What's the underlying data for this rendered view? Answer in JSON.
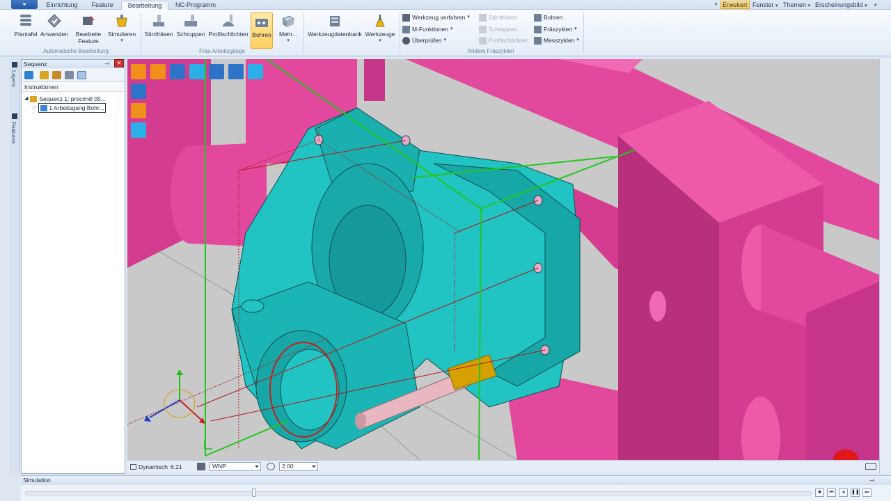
{
  "menu_tabs": [
    "Einrichtung",
    "Feature",
    "Bearbeitung",
    "NC-Programm"
  ],
  "menu_right": {
    "erweitert": "Erweitert",
    "fenster": "Fenster",
    "themen": "Themen",
    "erscheinungsbild": "Erscheinungsbild"
  },
  "ribbon": {
    "plantafel": "Plantafel",
    "anwenden": "Anwenden",
    "bearbeite_feature_1": "Bearbeite",
    "bearbeite_feature_2": "Feature",
    "simulieren": "Simulieren",
    "group_auto": "Automatische Bearbeitung",
    "stirnfraesen": "Stirnfräsen",
    "schruppen": "Schruppen",
    "profilschlichten": "Profilschlichten",
    "bohren": "Bohren",
    "mehr": "Mehr...",
    "group_fraes": "Fräs-Arbeitsgänge",
    "werkzeugdatenbank": "Werkzeugdatenbank",
    "werkzeuge": "Werkzeuge",
    "werkzeug_verfahren": "Werkzeug verfahren",
    "m_funktionen": "M-Funktionen",
    "ueberpruefen": "Überprüfen",
    "stirnfraesen_sm": "Stirnfräsen",
    "schruppen_sm": "Schruppen",
    "profilschlichten_sm": "Profilschlichten",
    "bohren_sm": "Bohren",
    "fraeszyklen": "Fräszyklen",
    "messzyklen": "Messzyklen",
    "group_andere": "Andere Fräszyklen"
  },
  "left_strip": {
    "layers": "Layers",
    "features": "Features"
  },
  "sequence_panel": {
    "title": "Sequenz",
    "column_header": "Instruktionen",
    "tree": [
      {
        "label": "Sequenz 1: precimill 05..."
      },
      {
        "label": "1 Arbeitsgang Bohr..."
      }
    ]
  },
  "viewport_status": {
    "mode": "Dynamisch",
    "value": "6.21",
    "coord_system": "WNP",
    "zoom": "2.00"
  },
  "simulation": {
    "title": "Simulation",
    "progress": 0.29
  },
  "colors": {
    "part": "#22c3c3",
    "fixture": "#e2489c",
    "tool_holder": "#d6a000",
    "background": "#c9c9c9"
  }
}
